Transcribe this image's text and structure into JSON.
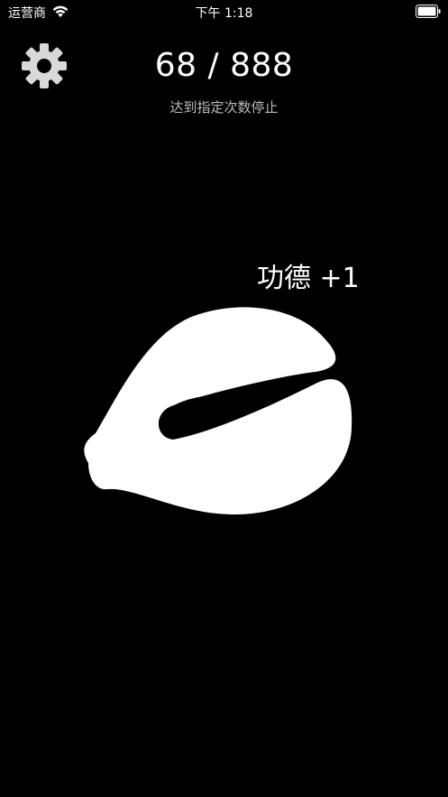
{
  "status_bar": {
    "carrier": "运营商",
    "time": "下午 1:18",
    "wifi_icon": "wifi-icon",
    "battery_icon": "battery-full-icon"
  },
  "header": {
    "settings_icon": "gear-icon",
    "count": "68",
    "separator": "/",
    "target": "888",
    "subtitle": "达到指定次数停止"
  },
  "main": {
    "merit_text": "功德 +1",
    "instrument_icon": "wooden-fish-icon"
  },
  "colors": {
    "background": "#000000",
    "foreground": "#ffffff",
    "subtitle": "#bbbbbb"
  }
}
